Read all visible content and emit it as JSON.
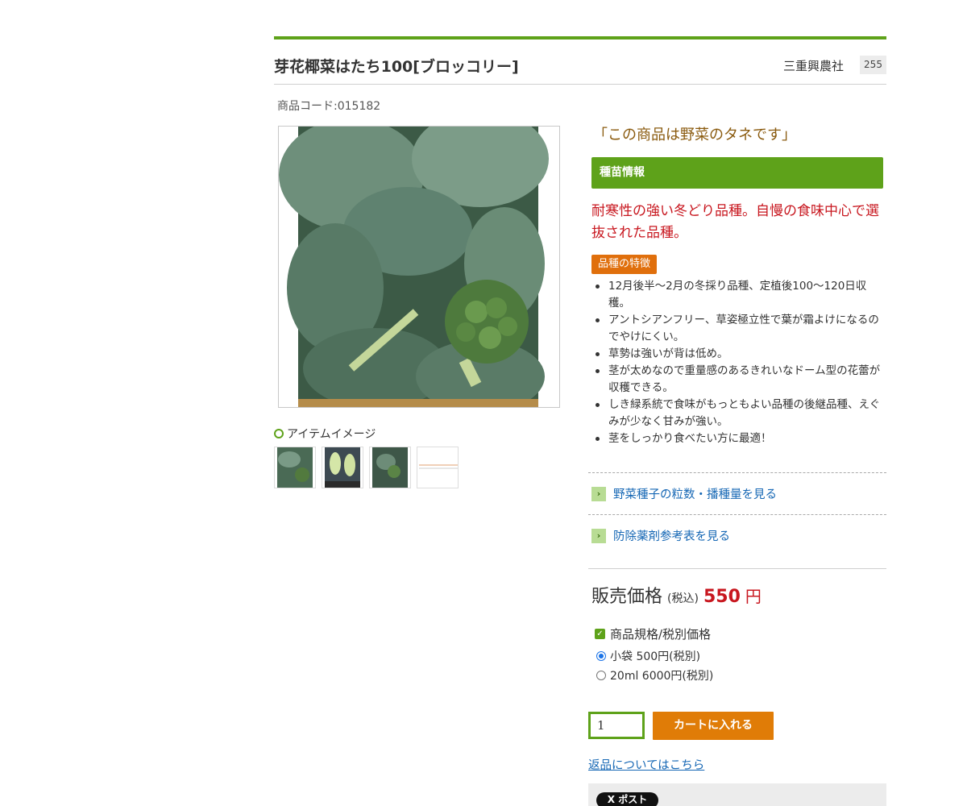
{
  "product": {
    "title": "芽花椰菜はたち100[ブロッコリー]",
    "maker": "三重興農社",
    "badge_count": "255",
    "code": "商品コード:015182"
  },
  "gallery": {
    "item_image_label": "アイテムイメージ",
    "thumbnails": [
      "broccoli-plant-photo",
      "broccoli-stems-photo",
      "broccoli-field-photo",
      "seed-table-image"
    ]
  },
  "seed": {
    "note": "「この商品は野菜のタネです」",
    "info_heading": "種苗情報",
    "catchphrase": "耐寒性の強い冬どり品種。自慢の食味中心で選抜された品種。",
    "feature_badge": "品種の特徴",
    "features": [
      "12月後半～2月の冬採り品種、定植後100～120日収穫。",
      "アントシアンフリー、草姿極立性で葉が霜よけになるのでやけにくい。",
      "草勢は強いが背は低め。",
      "茎が太めなので重量感のあるきれいなドーム型の花蕾が収穫できる。",
      "しき緑系統で食味がもっともよい品種の後継品種、えぐみが少なく甘みが強い。",
      "茎をしっかり食べたい方に最適！"
    ]
  },
  "links": {
    "seed_count": "野菜種子の粒数・播種量を見る",
    "pesticide": "防除薬剤参考表を見る",
    "returns": "返品についてはこちら"
  },
  "price": {
    "label": "販売価格",
    "tax": "(税込)",
    "value": "550",
    "unit": "円"
  },
  "spec": {
    "heading": "商品規格/税別価格",
    "options": [
      "小袋 500円(税別)",
      "20ml 6000円(税別)"
    ],
    "selected_index": 0
  },
  "cart": {
    "quantity": "1",
    "button_label": "カートに入れる"
  },
  "share": {
    "x_post_label": "X ポスト"
  },
  "colors": {
    "accent_green": "#5ea21a",
    "price_red": "#c8171f",
    "cart_orange": "#e07c07",
    "badge_orange": "#e06f0c",
    "link_blue": "#1768b5"
  }
}
